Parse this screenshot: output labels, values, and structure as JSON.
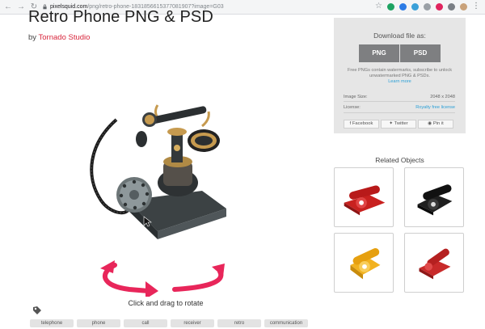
{
  "browser": {
    "url_host": "pixelsquid.com",
    "url_path": "/png/retro-phone-1831856615377081907?image=G03"
  },
  "product": {
    "title": "Retro Phone PNG & PSD",
    "by_prefix": "by",
    "author": "Tornado Studio"
  },
  "viewer": {
    "rotate_hint": "Click and drag to rotate"
  },
  "download": {
    "title": "Download file as:",
    "png_label": "PNG",
    "psd_label": "PSD",
    "note": "Free PNGs contain watermarks, subscribe to unlock unwatermarked PNG & PSDs.",
    "learn_more": "Learn more",
    "image_size_label": "Image Size:",
    "image_size_value": "2048 x 2048",
    "license_label": "License:",
    "license_value": "Royalty free license",
    "share": {
      "facebook": "Facebook",
      "twitter": "Twitter",
      "pin": "Pin it"
    }
  },
  "related": {
    "title": "Related Objects",
    "items": [
      {
        "color": "#c8211f",
        "handset": "#b81a1a"
      },
      {
        "color": "#1f1f1f",
        "handset": "#111111"
      },
      {
        "color": "#f2b21f",
        "handset": "#e6a010"
      },
      {
        "color": "#c82a2a",
        "handset": "#b52020"
      }
    ]
  },
  "tags": [
    "telephone",
    "phone",
    "call",
    "receiver",
    "retro",
    "communication"
  ],
  "colors": {
    "accent": "#d8263c",
    "link": "#2a9fd6",
    "rotate_arrow": "#e8265a"
  }
}
